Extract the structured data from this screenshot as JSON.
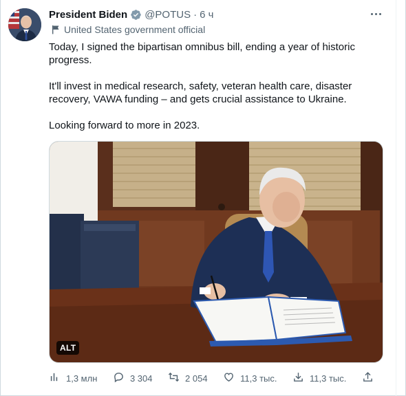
{
  "tweet": {
    "author_name": "President Biden",
    "handle": "@POTUS",
    "separator": "·",
    "time": "6 ч",
    "label": "United States government official",
    "text": [
      "Today, I signed the bipartisan omnibus bill, ending a year of historic progress.",
      "It'll invest in medical research, safety, veteran health care, disaster recovery, VAWA funding – and gets crucial assistance to Ukraine.",
      "Looking forward to more in 2023."
    ],
    "media": {
      "alt_badge": "ALT"
    },
    "actions": {
      "views": "1,3 млн",
      "replies": "3 304",
      "retweets": "2 054",
      "likes": "11,3 тыс.",
      "bookmarks": "11,3 тыс."
    }
  },
  "colors": {
    "verified": "#829aab",
    "secondary_text": "#536471",
    "primary_text": "#0f1419"
  },
  "icons": [
    "verified-badge-icon",
    "more-icon",
    "flag-icon",
    "views-icon",
    "reply-icon",
    "retweet-icon",
    "like-icon",
    "bookmark-icon",
    "share-icon"
  ]
}
